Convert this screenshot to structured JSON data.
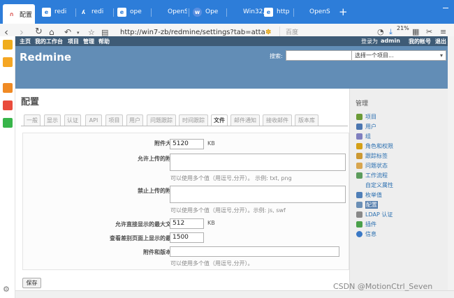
{
  "browser": {
    "tabs": [
      {
        "label": "配置",
        "icon": "redmine-icon"
      },
      {
        "label": "redi",
        "icon": "ie-icon"
      },
      {
        "label": "redi",
        "icon": "cat-icon"
      },
      {
        "label": "ope",
        "icon": "ie-icon"
      },
      {
        "label": "OpenS",
        "icon": "openssl-icon"
      },
      {
        "label": "Ope",
        "icon": "w-icon"
      },
      {
        "label": "Win32,",
        "icon": "ie-icon"
      },
      {
        "label": "http",
        "icon": "ie-icon"
      },
      {
        "label": "OpenS",
        "icon": "ie-icon"
      }
    ],
    "new_tab": "+",
    "url": "http://win7-zb/redmine/settings?tab=atta",
    "search_placeholder": "百度",
    "zoom": "21%"
  },
  "redmine": {
    "top_menu": [
      "主页",
      "我的工作台",
      "项目",
      "管理",
      "帮助"
    ],
    "login_prefix": "登录为",
    "login_user": "admin",
    "account": "我的帐号",
    "logout": "退出",
    "app_title": "Redmine",
    "search_label": "搜索:",
    "project_select": "选择一个项目...",
    "page_title": "配置",
    "settings_tabs": [
      "一般",
      "显示",
      "认证",
      "API",
      "项目",
      "用户",
      "问题跟踪",
      "时间跟踪",
      "文件",
      "邮件通知",
      "接收邮件",
      "版本库"
    ],
    "active_tab": "文件",
    "form": {
      "max_size_label": "附件大小限制",
      "max_size_value": "5120",
      "max_size_unit": "KB",
      "allowed_label": "允许上传的附件类型",
      "allowed_hint": "可以使用多个值（用逗号,分开）。 示例: txt, png",
      "denied_label": "禁止上传的附件类型",
      "denied_hint": "可以使用多个值（用逗号,分开）。示例: js, swf",
      "text_size_label": "允许直接显示的最大文本文件",
      "text_size_value": "512",
      "text_size_unit": "KB",
      "diff_label": "查看差别页面上显示的最大行数",
      "diff_value": "1500",
      "encodings_label": "附件和版本库编码",
      "encodings_hint": "可以使用多个值（用逗号,分开）。",
      "save_label": "保存"
    },
    "admin_menu_title": "管理",
    "admin_menu": [
      {
        "label": "项目",
        "icon": "projects-icon",
        "color": "#6b9b37"
      },
      {
        "label": "用户",
        "icon": "user-icon",
        "color": "#4b76b0"
      },
      {
        "label": "组",
        "icon": "group-icon",
        "color": "#7f7fbf"
      },
      {
        "label": "角色和权限",
        "icon": "key-icon",
        "color": "#d4a017"
      },
      {
        "label": "跟踪标签",
        "icon": "ticket-icon",
        "color": "#cc9933"
      },
      {
        "label": "问题状态",
        "icon": "status-icon",
        "color": "#d8a64f"
      },
      {
        "label": "工作流程",
        "icon": "workflow-icon",
        "color": "#5c9c5c"
      },
      {
        "label": "自定义属性",
        "icon": "custom-icon",
        "color": "#eeeeee"
      },
      {
        "label": "枚举值",
        "icon": "list-icon",
        "color": "#4f7fb8"
      },
      {
        "label": "配置",
        "icon": "settings-icon",
        "color": "#6b8fb6"
      },
      {
        "label": "LDAP 认证",
        "icon": "server-icon",
        "color": "#888888"
      },
      {
        "label": "插件",
        "icon": "plugin-icon",
        "color": "#4aa04a"
      },
      {
        "label": "信息",
        "icon": "info-icon",
        "color": "#3a78c5"
      }
    ],
    "selected_admin_item": "配置"
  },
  "watermark": "CSDN @MotionCtrl_Seven"
}
